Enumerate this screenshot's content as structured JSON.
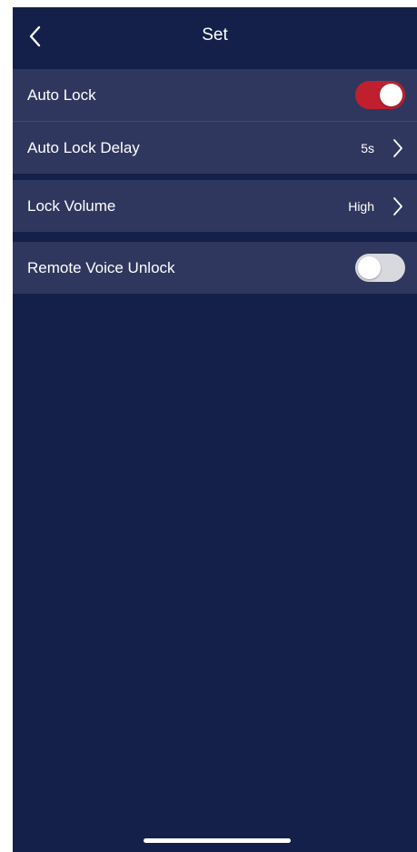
{
  "header": {
    "title": "Set",
    "back_icon": "chevron-left-icon"
  },
  "settings": {
    "auto_lock": {
      "label": "Auto Lock",
      "enabled": true,
      "toggle_color": "#c0202d"
    },
    "auto_lock_delay": {
      "label": "Auto Lock Delay",
      "value": "5s"
    },
    "lock_volume": {
      "label": "Lock Volume",
      "value": "High"
    },
    "remote_voice_unlock": {
      "label": "Remote Voice Unlock",
      "enabled": false
    }
  },
  "colors": {
    "background": "#142049",
    "row_background": "#30375e",
    "text": "#ffffff"
  }
}
